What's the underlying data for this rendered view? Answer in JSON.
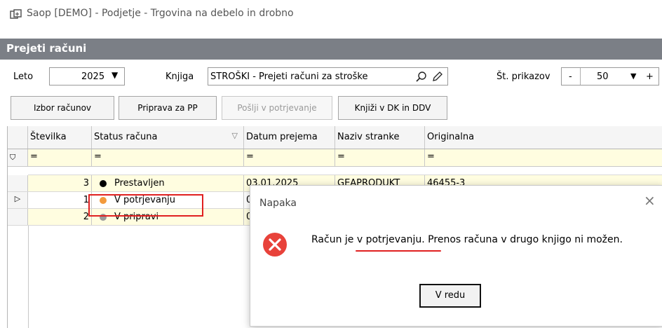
{
  "window": {
    "title": "Saop  [DEMO] - Podjetje - Trgovina na debelo in drobno"
  },
  "module": {
    "title": "Prejeti računi"
  },
  "filters": {
    "leto_label": "Leto",
    "leto_value": "2025",
    "knjiga_label": "Knjiga",
    "knjiga_value": "STROŠKI - Prejeti računi za stroške",
    "prikazov_label": "Št. prikazov",
    "minus": "-",
    "prikazov_value": "50",
    "plus": "+"
  },
  "toolbar": {
    "izbor": "Izbor računov",
    "priprava": "Priprava za PP",
    "poslji": "Pošlji v potrjevanje",
    "knjizi": "Knjiži v DK in DDV"
  },
  "grid": {
    "columns": [
      "Številka",
      "Status računa",
      "Datum prejema",
      "Naziv stranke",
      "Originalna"
    ],
    "filter_symbol": "=",
    "rows": [
      {
        "stevilka": "3",
        "status": "Prestavljen",
        "status_color": "#000000",
        "datum": "03.01.2025",
        "stranka": "GEAPRODUKT",
        "originalna": "46455-3"
      },
      {
        "stevilka": "1",
        "status": "V potrjevanju",
        "status_color": "#f39a3c",
        "datum": "0",
        "stranka": "",
        "originalna": ""
      },
      {
        "stevilka": "2",
        "status": "V pripravi",
        "status_color": "#9a9a9a",
        "datum": "0",
        "stranka": "",
        "originalna": ""
      }
    ]
  },
  "dialog": {
    "title": "Napaka",
    "message": "Račun je v potrjevanju. Prenos računa v drugo knjigo ni možen.",
    "ok": "V redu",
    "close": "×"
  },
  "colors": {
    "header_bg": "#7b7f86",
    "highlight": "#e02020",
    "error_icon": "#e8423a",
    "filter_row": "#fffde0"
  }
}
